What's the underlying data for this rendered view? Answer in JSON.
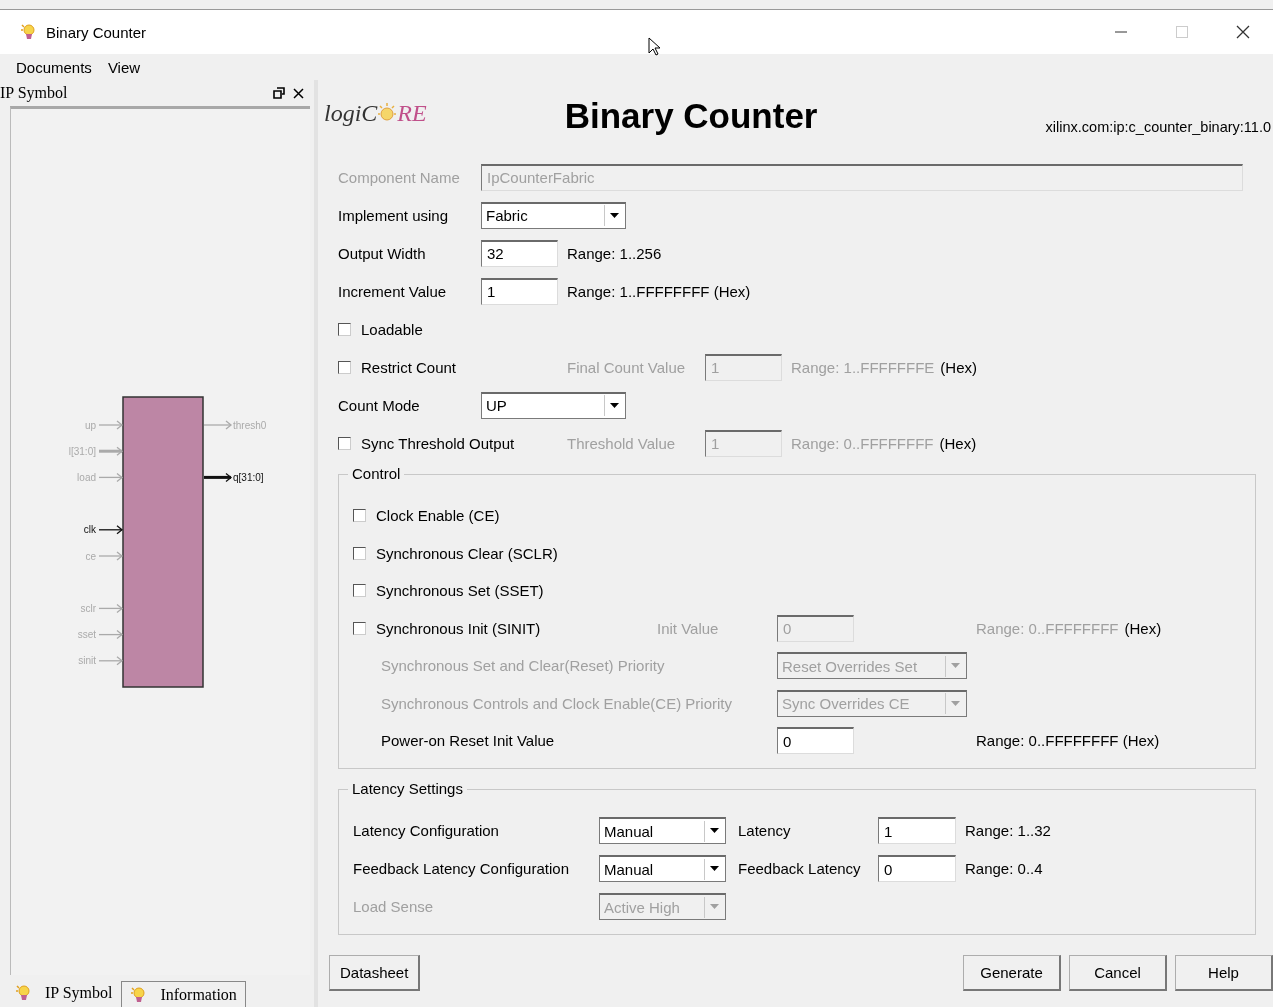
{
  "window": {
    "title": "Binary Counter"
  },
  "menu": [
    "Documents",
    "View"
  ],
  "side_panel": {
    "title": "IP Symbol",
    "inputs": [
      {
        "name": "up",
        "active": false,
        "bus": false
      },
      {
        "name": "l[31:0]",
        "active": false,
        "bus": true
      },
      {
        "name": "load",
        "active": false,
        "bus": false
      },
      {
        "name": "clk",
        "active": true,
        "bus": false
      },
      {
        "name": "ce",
        "active": false,
        "bus": false
      },
      {
        "name": "sclr",
        "active": false,
        "bus": false
      },
      {
        "name": "sset",
        "active": false,
        "bus": false
      },
      {
        "name": "sinit",
        "active": false,
        "bus": false
      }
    ],
    "outputs": [
      {
        "name": "thresh0",
        "active": false,
        "bus": false
      },
      {
        "name": "q[31:0]",
        "active": true,
        "bus": true
      }
    ],
    "tabs": [
      {
        "label": "IP Symbol",
        "selected": true
      },
      {
        "label": "Information",
        "selected": false
      }
    ]
  },
  "header": {
    "logo_parts": [
      "logiC",
      "RE"
    ],
    "title": "Binary Counter",
    "vlnv": "xilinx.com:ip:c_counter_binary:11.0"
  },
  "options": [
    {
      "kind": "text",
      "label": "Component Name",
      "value": "IpCounterFabric",
      "disabled": true
    },
    {
      "kind": "dropdown",
      "label": "Implement using",
      "value": "Fabric",
      "disabled": false
    },
    {
      "kind": "number",
      "label": "Output Width",
      "value": "32",
      "range": "Range: 1..256",
      "disabled": false
    },
    {
      "kind": "number",
      "label": "Increment Value",
      "value": "1",
      "range": "Range: 1..FFFFFFFF (Hex)",
      "disabled": false
    },
    {
      "kind": "checkbox",
      "label": "Loadable",
      "checked": false
    },
    {
      "kind": "checkbox",
      "label": "Restrict Count",
      "checked": false,
      "sub": {
        "label": "Final Count Value",
        "value": "1",
        "range": "Range: 1..FFFFFFFE",
        "hex": "(Hex)",
        "disabled": true
      }
    },
    {
      "kind": "dropdown",
      "label": "Count Mode",
      "value": "UP",
      "disabled": false
    },
    {
      "kind": "checkbox",
      "label": "Sync Threshold Output",
      "checked": false,
      "sub": {
        "label": "Threshold Value",
        "value": "1",
        "range": "Range: 0..FFFFFFFF",
        "hex": "(Hex)",
        "disabled": true
      }
    }
  ],
  "control": {
    "title": "Control",
    "rows": [
      {
        "kind": "checkbox",
        "label": "Clock Enable (CE)",
        "checked": false
      },
      {
        "kind": "checkbox",
        "label": "Synchronous Clear (SCLR)",
        "checked": false
      },
      {
        "kind": "checkbox",
        "label": "Synchronous Set (SSET)",
        "checked": false
      },
      {
        "kind": "checkbox",
        "label": "Synchronous Init (SINIT)",
        "checked": false,
        "sub": {
          "label": "Init Value",
          "value": "0",
          "range": "Range: 0..FFFFFFFF",
          "hex": "(Hex)",
          "disabled": true
        }
      },
      {
        "kind": "dropdown",
        "label": "Synchronous Set and Clear(Reset) Priority",
        "value": "Reset Overrides Set",
        "disabled": true
      },
      {
        "kind": "dropdown",
        "label": "Synchronous Controls and Clock Enable(CE) Priority",
        "value": "Sync Overrides CE",
        "disabled": true
      },
      {
        "kind": "number",
        "label": "Power-on Reset Init Value",
        "value": "0",
        "range": "Range: 0..FFFFFFFF (Hex)",
        "disabled": false
      }
    ]
  },
  "latency": {
    "title": "Latency Settings",
    "rows": [
      {
        "label": "Latency Configuration",
        "value": "Manual",
        "disabled": false,
        "sub": {
          "label": "Latency",
          "value": "1",
          "range": "Range: 1..32"
        }
      },
      {
        "label": "Feedback Latency Configuration",
        "value": "Manual",
        "disabled": false,
        "sub": {
          "label": "Feedback Latency",
          "value": "0",
          "range": "Range: 0..4"
        }
      },
      {
        "label": "Load Sense",
        "value": "Active High",
        "disabled": true
      }
    ]
  },
  "buttons": [
    {
      "label": "Datasheet"
    },
    {
      "label": "Generate"
    },
    {
      "label": "Cancel"
    },
    {
      "label": "Help"
    }
  ]
}
